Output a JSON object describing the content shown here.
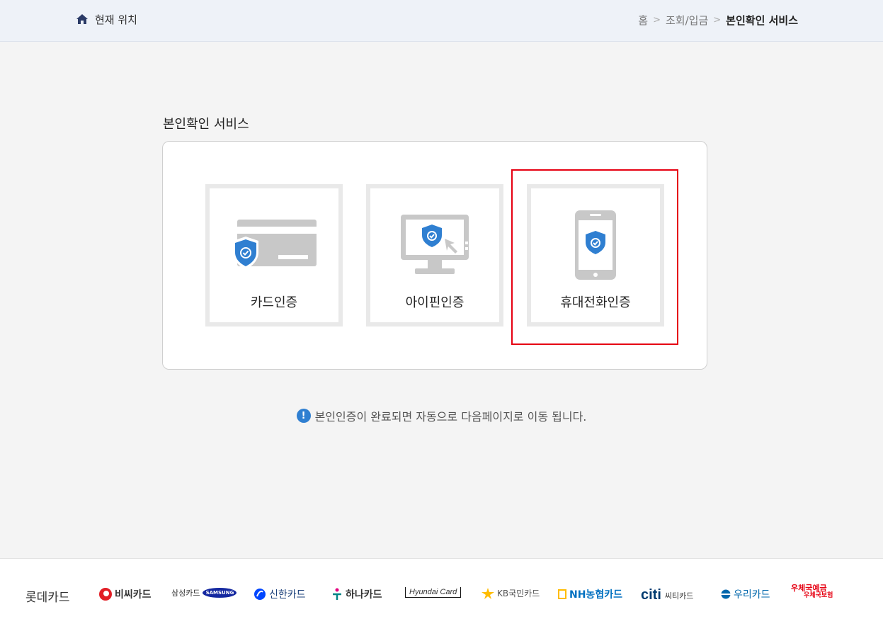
{
  "header": {
    "location_label": "현재 위치",
    "breadcrumb": [
      "홈",
      "조회/입금",
      "본인확인 서비스"
    ],
    "separator": ">"
  },
  "main": {
    "title": "본인확인 서비스",
    "options": [
      {
        "label": "카드인증",
        "icon": "card-shield-icon"
      },
      {
        "label": "아이핀인증",
        "icon": "monitor-shield-icon"
      },
      {
        "label": "휴대전화인증",
        "icon": "phone-shield-icon",
        "highlighted": true
      }
    ],
    "notice": "본인인증이 완료되면 자동으로 다음페이지로 이동 됩니다."
  },
  "footer": {
    "brands": [
      {
        "name": "롯데카드",
        "color": "#333333"
      },
      {
        "name": "비씨카드",
        "color": "#e21e26"
      },
      {
        "name": "삼성카드",
        "sub": "SAMSUNG",
        "color": "#1428a0"
      },
      {
        "name": "신한카드",
        "color": "#0046ff"
      },
      {
        "name": "하나카드",
        "color": "#008485"
      },
      {
        "name": "Hyundai Card",
        "color": "#111111"
      },
      {
        "name": "KB국민카드",
        "color": "#ffbc00"
      },
      {
        "name": "NH농협카드",
        "color": "#0070c0"
      },
      {
        "name": "citi",
        "sub": "씨티카드",
        "color": "#003b70"
      },
      {
        "name": "우리카드",
        "color": "#0067ac"
      },
      {
        "name": "우체국예금",
        "sub": "우체국보험",
        "color": "#e60012"
      }
    ]
  },
  "colors": {
    "accent": "#2f7fd1",
    "highlight": "#e60012",
    "icon_gray": "#c8c8c8"
  }
}
